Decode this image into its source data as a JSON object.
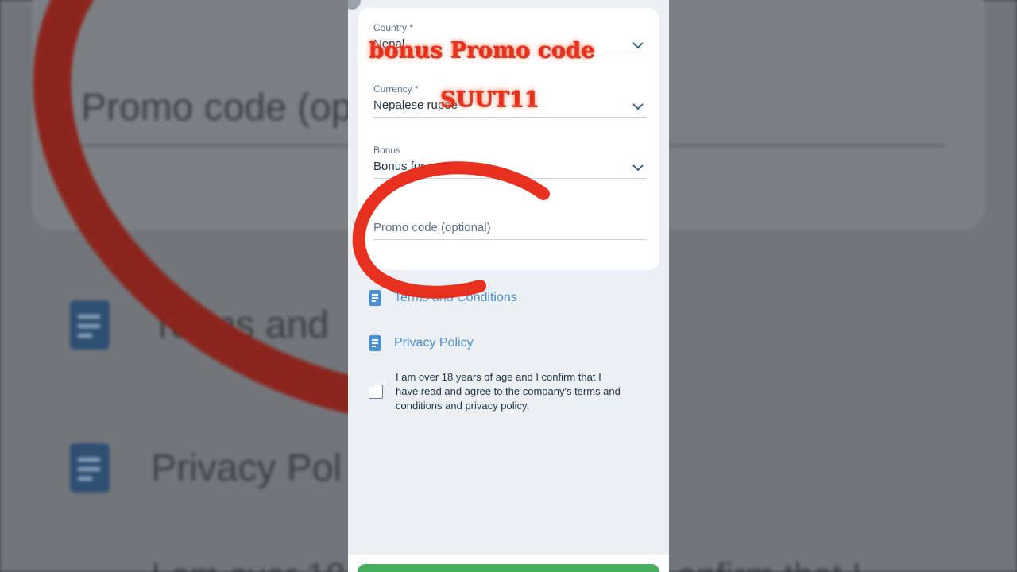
{
  "background": {
    "promo_label": "Promo code (op",
    "terms_label": "Terms and",
    "privacy_label": "Privacy Pol",
    "consent_fragment_left": "I am over 18",
    "consent_fragment_right": "onfirm that I"
  },
  "form": {
    "country": {
      "label": "Country *",
      "value": "Nepal"
    },
    "currency": {
      "label": "Currency *",
      "value": "Nepalese rupee"
    },
    "bonus": {
      "label": "Bonus",
      "value": "Bonus for sports"
    },
    "promo": {
      "placeholder": "Promo code (optional)"
    }
  },
  "links": {
    "terms": "Terms and Conditions",
    "privacy": "Privacy Policy"
  },
  "consent": {
    "text": "I am over 18 years of age and I confirm that I have read and agree to the company's terms and conditions and privacy policy."
  },
  "overlay": {
    "title": "bonus Promo code",
    "code": "SUUT11"
  },
  "colors": {
    "accent_link": "#4a8fcf",
    "overlay_red": "#e8301f",
    "button_green": "#45ad5d"
  },
  "icons": [
    "chevron-down-icon",
    "document-icon",
    "checkbox-icon"
  ]
}
